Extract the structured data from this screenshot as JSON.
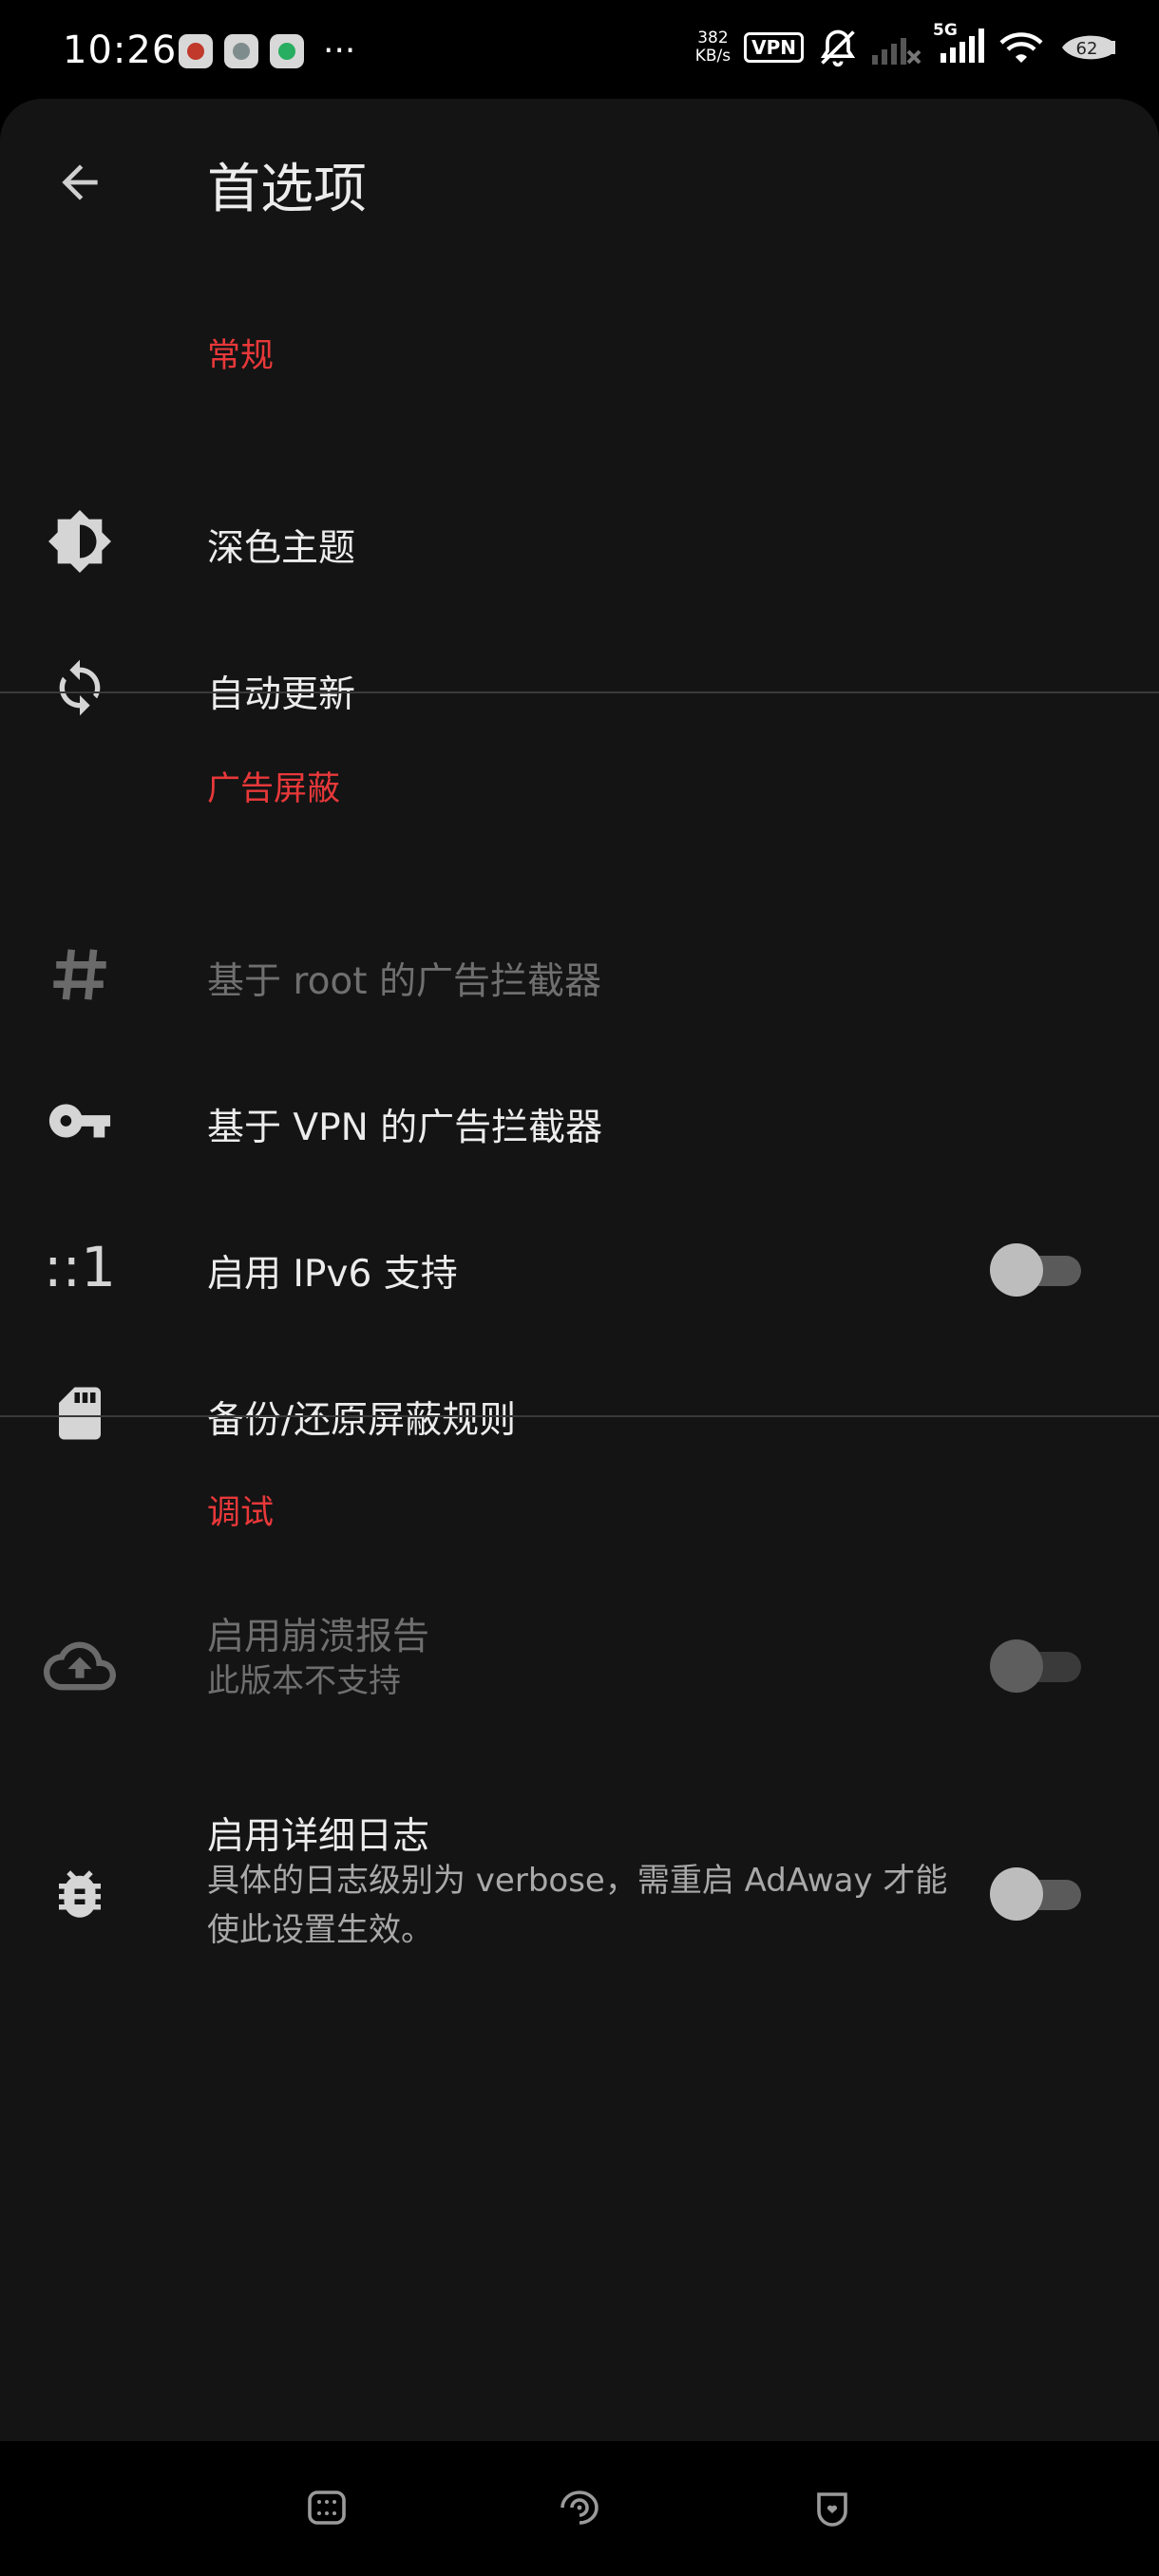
{
  "status_bar": {
    "time": "10:26",
    "more_indicator": "···",
    "net_speed_value": "382",
    "net_speed_unit": "KB/s",
    "vpn_label": "VPN",
    "network_type": "5G",
    "battery_level": "62"
  },
  "toolbar": {
    "title": "首选项",
    "back_icon": "arrow-back-icon"
  },
  "sections": {
    "general": {
      "header": "常规",
      "items": {
        "dark_theme": {
          "title": "深色主题",
          "icon": "brightness-icon"
        },
        "auto_update": {
          "title": "自动更新",
          "icon": "sync-icon"
        }
      }
    },
    "ad_blocking": {
      "header": "广告屏蔽",
      "items": {
        "root_blocker": {
          "title": "基于 root 的广告拦截器",
          "icon": "hash-icon",
          "enabled": false
        },
        "vpn_blocker": {
          "title": "基于 VPN 的广告拦截器",
          "icon": "key-icon"
        },
        "ipv6": {
          "title": "启用 IPv6 支持",
          "icon_text": "::1",
          "switch_on": false
        },
        "backup": {
          "title": "备份/还原屏蔽规则",
          "icon": "sd-card-icon"
        }
      }
    },
    "debug": {
      "header": "调试",
      "items": {
        "crash_report": {
          "title": "启用崩溃报告",
          "summary": "此版本不支持",
          "icon": "cloud-upload-icon",
          "enabled": false,
          "switch_on": false
        },
        "verbose_log": {
          "title": "启用详细日志",
          "summary": "具体的日志级别为 verbose，需重启 AdAway 才能使此设置生效。",
          "icon": "bug-icon",
          "switch_on": false
        }
      }
    }
  },
  "colors": {
    "background": "#141414",
    "section_header": "#e8383a",
    "text_primary": "#ececec",
    "text_secondary": "#a9a9a9",
    "text_disabled": "#6f6f6f"
  },
  "nav_bar": {
    "buttons": [
      "menu-icon",
      "home-icon",
      "back-icon"
    ]
  }
}
